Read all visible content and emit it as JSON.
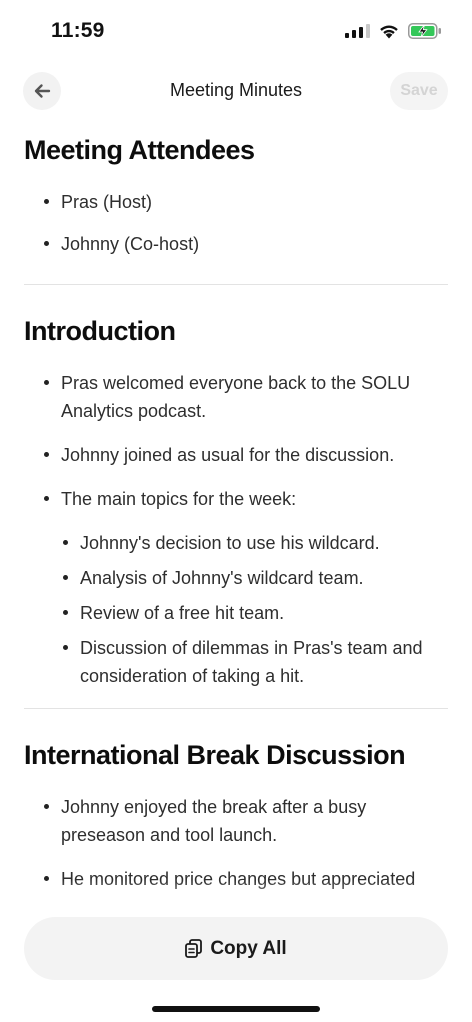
{
  "status": {
    "time": "11:59",
    "battery_color": "#34c759"
  },
  "nav": {
    "title": "Meeting Minutes",
    "save_label": "Save",
    "back_icon": "arrow-left-icon"
  },
  "sections": [
    {
      "title": "Meeting Attendees",
      "items": [
        "Pras (Host)",
        "Johnny (Co-host)"
      ]
    },
    {
      "title": "Introduction",
      "items": [
        "Pras welcomed everyone back to the SOLU Analytics podcast.",
        "Johnny joined as usual for the discussion.",
        "The main topics for the week:"
      ],
      "subitems": [
        "Johnny's decision to use his wildcard.",
        "Analysis of Johnny's wildcard team.",
        "Review of a free hit team.",
        "Discussion of dilemmas in Pras's team and consideration of taking a hit."
      ]
    },
    {
      "title": "International Break Discussion",
      "items": [
        "Johnny enjoyed the break after a busy preseason and tool launch.",
        "He monitored price changes but appreciated"
      ]
    }
  ],
  "footer": {
    "copy_all_label": "Copy All",
    "copy_icon": "copy-icon"
  }
}
